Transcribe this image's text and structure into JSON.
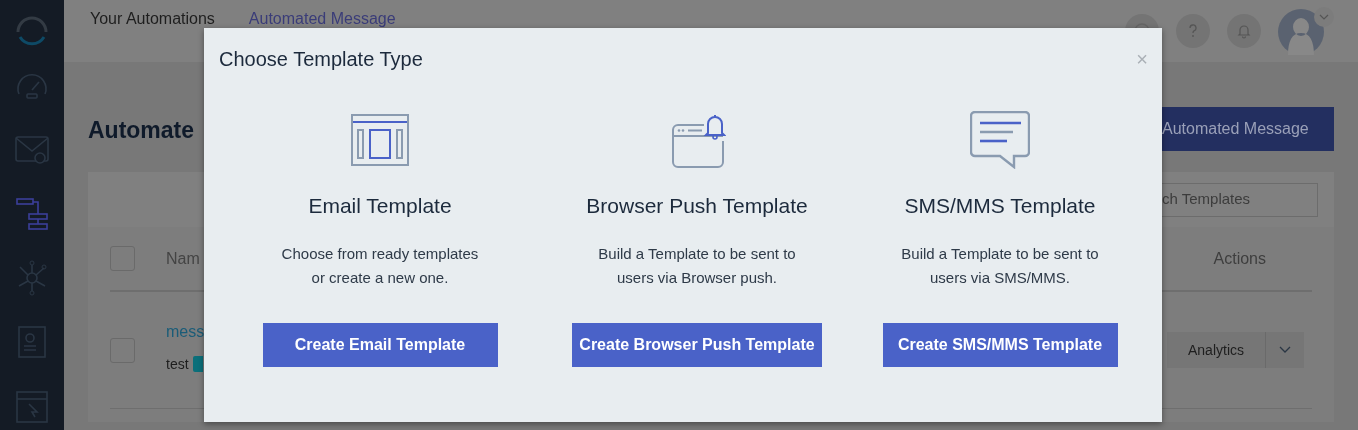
{
  "sidebar": {
    "items": [
      {
        "selected": false
      },
      {
        "selected": false
      },
      {
        "selected": true
      },
      {
        "selected": false
      },
      {
        "selected": false
      },
      {
        "selected": false
      }
    ]
  },
  "topbar": {
    "breadcrumbs": [
      {
        "label": "Your Automations",
        "current": false
      },
      {
        "label": "Automated Message",
        "current": true
      }
    ]
  },
  "page": {
    "heading": "Automate",
    "new_button": "Automated Message",
    "search": {
      "placeholder": "ch Templates"
    },
    "table": {
      "select_all_checked": false,
      "columns": [
        "Nam",
        "Actions"
      ],
      "rows": [
        {
          "checked": false,
          "name": "mess",
          "subtitle": "test",
          "action": "Analytics"
        }
      ]
    }
  },
  "modal": {
    "title": "Choose Template Type",
    "close": "×",
    "options": [
      {
        "title": "Email Template",
        "description_lines": [
          "Choose from ready templates",
          "or create a new one."
        ],
        "button": "Create Email Template"
      },
      {
        "title": "Browser Push Template",
        "description_lines": [
          "Build a Template to be sent to",
          "users via Browser push."
        ],
        "button": "Create Browser Push Template"
      },
      {
        "title": "SMS/MMS Template",
        "description_lines": [
          "Build a Template to be sent to",
          "users via SMS/MMS."
        ],
        "button": "Create SMS/MMS Template"
      }
    ]
  }
}
